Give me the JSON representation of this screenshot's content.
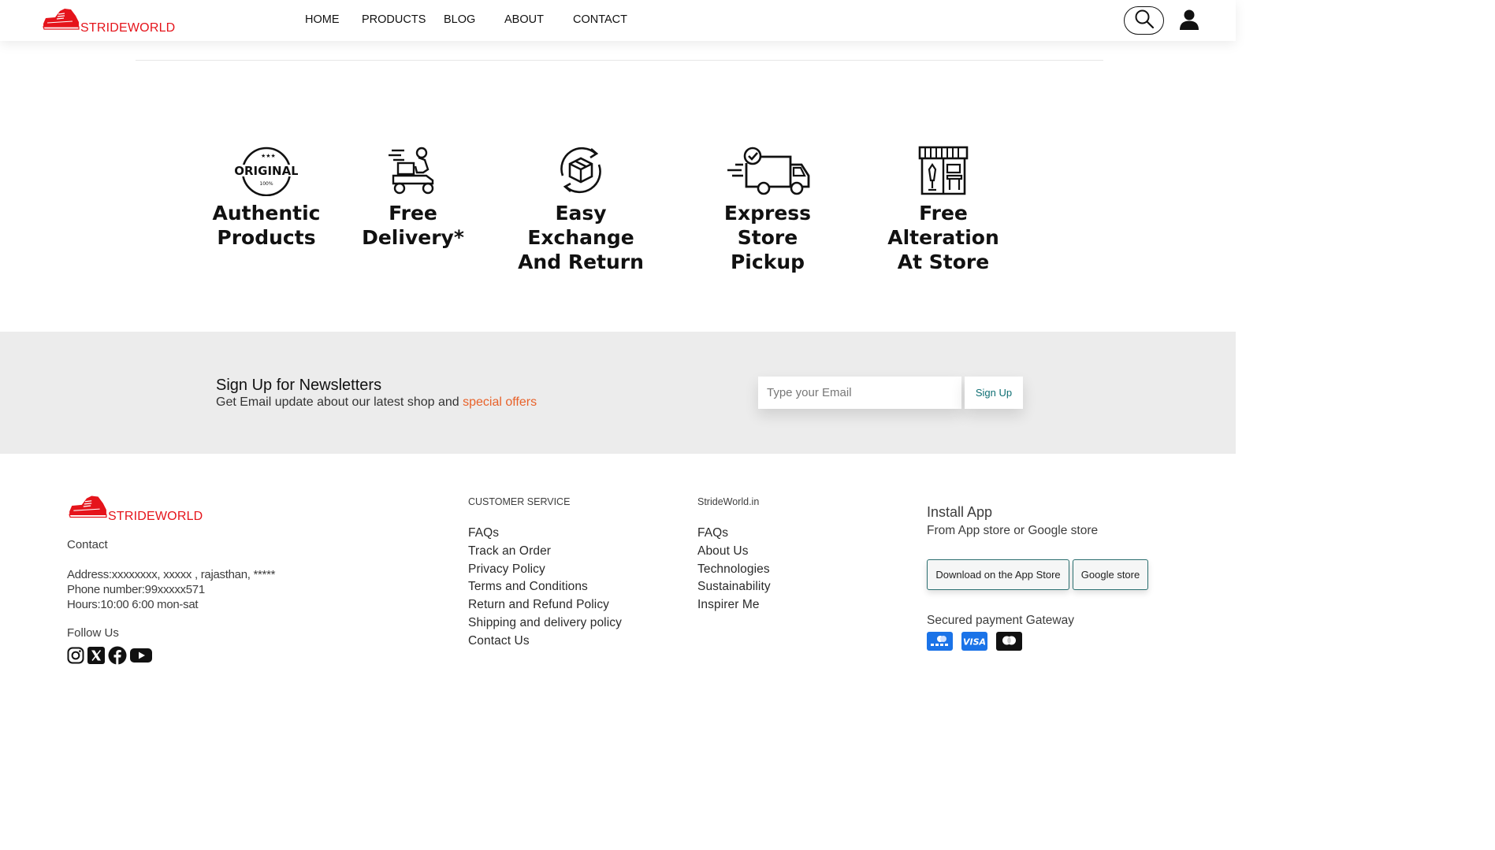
{
  "header": {
    "brand": "STRIDEWORLD",
    "nav": [
      "HOME",
      "PRODUCTS",
      "BLOG",
      "ABOUT",
      "CONTACT"
    ]
  },
  "features": [
    {
      "icon": "original-badge-icon",
      "title": "Authentic\nProducts",
      "badge_top": "ORIGINAL",
      "badge_sub": "100%"
    },
    {
      "icon": "delivery-scooter-icon",
      "title": "Free\nDelivery*"
    },
    {
      "icon": "exchange-box-icon",
      "title": "Easy Exchange\nAnd Return"
    },
    {
      "icon": "truck-check-icon",
      "title": "Express\nStore Pickup"
    },
    {
      "icon": "tailor-store-icon",
      "title": "Free Alteration\nAt Store"
    }
  ],
  "newsletter": {
    "title": "Sign Up for Newsletters",
    "subtitle": "Get Email update about our latest shop and ",
    "subtitle_highlight": "special offers",
    "email_placeholder": "Type your Email",
    "button": "Sign Up"
  },
  "footer": {
    "brand": "STRIDEWORLD",
    "contact_heading": "Contact",
    "address": "Address:xxxxxxxx, xxxxx , rajasthan, *****",
    "phone": "Phone number:99xxxxx571",
    "hours": "Hours:10:00 6:00 mon-sat",
    "follow_heading": "Follow Us",
    "socials": [
      "instagram-icon",
      "x-twitter-icon",
      "facebook-icon",
      "youtube-icon"
    ],
    "customer_service": {
      "heading": "CUSTOMER SERVICE",
      "links": [
        "FAQs",
        "Track an Order",
        "Privacy  Policy",
        "Terms and Conditions",
        "Return and  Refund  Policy",
        "Shipping and delivery policy",
        "Contact Us"
      ]
    },
    "strideworld": {
      "heading": "StrideWorld.in",
      "links": [
        "FAQs",
        "About Us",
        "Technologies",
        "Sustainability",
        "Inspirer  Me"
      ]
    },
    "install": {
      "heading": "Install App",
      "subtitle": "From App store or Google store",
      "app_store": "Download on the App Store",
      "google_store": "Google store"
    },
    "payment": {
      "heading": "Secured payment Gateway",
      "cards": [
        "generic-card-icon",
        "visa-icon",
        "mastercard-icon"
      ],
      "visa_label": "VISA"
    }
  },
  "colors": {
    "brand_red": "#e5141b",
    "offer_orange": "#e8622a",
    "accent_teal": "#0e6f73",
    "newsletter_bg": "#ececec"
  }
}
